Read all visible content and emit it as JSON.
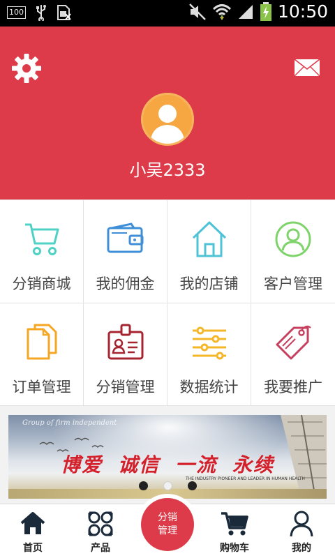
{
  "status_bar": {
    "time": "10:50",
    "battery_badge": "100",
    "icons": [
      "battery-100-icon",
      "usb-icon",
      "sim-icon",
      "mute-icon",
      "wifi-icon",
      "signal-icon",
      "battery-charging-icon"
    ]
  },
  "header": {
    "username": "小吴2333",
    "background_color": "#dd3b49",
    "left_icon": "gear-icon",
    "right_icon": "mail-icon"
  },
  "grid": {
    "items": [
      {
        "label": "分销商城",
        "icon": "cart-icon",
        "color": "#4fd1c5"
      },
      {
        "label": "我的佣金",
        "icon": "wallet-icon",
        "color": "#3f8fd8"
      },
      {
        "label": "我的店铺",
        "icon": "home-icon",
        "color": "#4fc3d6"
      },
      {
        "label": "客户管理",
        "icon": "customer-icon",
        "color": "#7ed36b"
      },
      {
        "label": "订单管理",
        "icon": "documents-icon",
        "color": "#f5a623"
      },
      {
        "label": "分销管理",
        "icon": "id-card-icon",
        "color": "#a52430"
      },
      {
        "label": "数据统计",
        "icon": "sliders-icon",
        "color": "#f5b72a"
      },
      {
        "label": "我要推广",
        "icon": "tag-icon",
        "color": "#c8405f"
      }
    ]
  },
  "banner": {
    "tagline": "Group of firm independent",
    "slogan": [
      "博爱",
      "诚信",
      "一流",
      "永续"
    ],
    "english": "THE INDUSTRY PIONEER AND LEADER IN HUMAN HEALTH",
    "slides": 3,
    "active_slide": 2
  },
  "bottom_nav": {
    "items": [
      {
        "label": "首页",
        "icon": "home-icon"
      },
      {
        "label": "产品",
        "icon": "product-icon"
      },
      {
        "label": "购物车",
        "icon": "cart-icon"
      },
      {
        "label": "我的",
        "icon": "user-icon"
      }
    ],
    "center_line1": "分销",
    "center_line2": "管理"
  }
}
